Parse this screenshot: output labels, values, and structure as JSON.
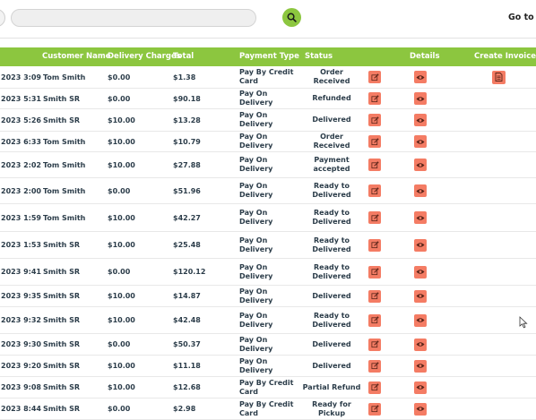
{
  "topbar": {
    "search_placeholder": "",
    "go_to_label": "Go to Pa"
  },
  "table": {
    "headers": {
      "customer_name": "Customer Name",
      "delivery_charges": "Delivery Charges",
      "total": "Total",
      "payment_type": "Payment Type",
      "status": "Status",
      "details": "Details",
      "create_invoice": "Create Invoice"
    },
    "rows": [
      {
        "date": "2023 3:09",
        "customer": "Tom Smith",
        "charges": "$0.00",
        "total": "$1.38",
        "payment": "Pay By Credit Card",
        "status": "Order Received",
        "invoice": true
      },
      {
        "date": "2023 5:31",
        "customer": "Smith SR",
        "charges": "$0.00",
        "total": "$90.18",
        "payment": "Pay On Delivery",
        "status": "Refunded",
        "invoice": false
      },
      {
        "date": "2023 5:26",
        "customer": "Smith SR",
        "charges": "$10.00",
        "total": "$13.28",
        "payment": "Pay On Delivery",
        "status": "Delivered",
        "invoice": false
      },
      {
        "date": "2023 6:33",
        "customer": "Tom Smith",
        "charges": "$10.00",
        "total": "$10.79",
        "payment": "Pay On Delivery",
        "status": "Order Received",
        "invoice": false
      },
      {
        "date": "2023 2:02",
        "customer": "Tom Smith",
        "charges": "$10.00",
        "total": "$27.88",
        "payment": "Pay On Delivery",
        "status": "Payment accepted",
        "invoice": false
      },
      {
        "date": "2023 2:00",
        "customer": "Tom Smith",
        "charges": "$0.00",
        "total": "$51.96",
        "payment": "Pay On Delivery",
        "status": "Ready to Delivered",
        "invoice": false
      },
      {
        "date": "2023 1:59",
        "customer": "Tom Smith",
        "charges": "$10.00",
        "total": "$42.27",
        "payment": "Pay On Delivery",
        "status": "Ready to Delivered",
        "invoice": false
      },
      {
        "date": "2023 1:53",
        "customer": "Smith SR",
        "charges": "$10.00",
        "total": "$25.48",
        "payment": "Pay On Delivery",
        "status": "Ready to Delivered",
        "invoice": false
      },
      {
        "date": "2023 9:41",
        "customer": "Smith SR",
        "charges": "$0.00",
        "total": "$120.12",
        "payment": "Pay On Delivery",
        "status": "Ready to Delivered",
        "invoice": false
      },
      {
        "date": "2023 9:35",
        "customer": "Smith SR",
        "charges": "$10.00",
        "total": "$14.87",
        "payment": "Pay On Delivery",
        "status": "Delivered",
        "invoice": false
      },
      {
        "date": "2023 9:32",
        "customer": "Smith SR",
        "charges": "$10.00",
        "total": "$42.48",
        "payment": "Pay On Delivery",
        "status": "Ready to Delivered",
        "invoice": false
      },
      {
        "date": "2023 9:30",
        "customer": "Smith SR",
        "charges": "$0.00",
        "total": "$50.37",
        "payment": "Pay On Delivery",
        "status": "Delivered",
        "invoice": false
      },
      {
        "date": "2023 9:20",
        "customer": "Smith SR",
        "charges": "$10.00",
        "total": "$11.18",
        "payment": "Pay On Delivery",
        "status": "Delivered",
        "invoice": false
      },
      {
        "date": "2023 9:08",
        "customer": "Smith SR",
        "charges": "$10.00",
        "total": "$12.68",
        "payment": "Pay By Credit Card",
        "status": "Partial Refund",
        "invoice": false
      },
      {
        "date": "2023 8:44",
        "customer": "Smith SR",
        "charges": "$0.00",
        "total": "$2.98",
        "payment": "Pay By Credit Card",
        "status": "Ready for Pickup",
        "invoice": false
      }
    ]
  }
}
